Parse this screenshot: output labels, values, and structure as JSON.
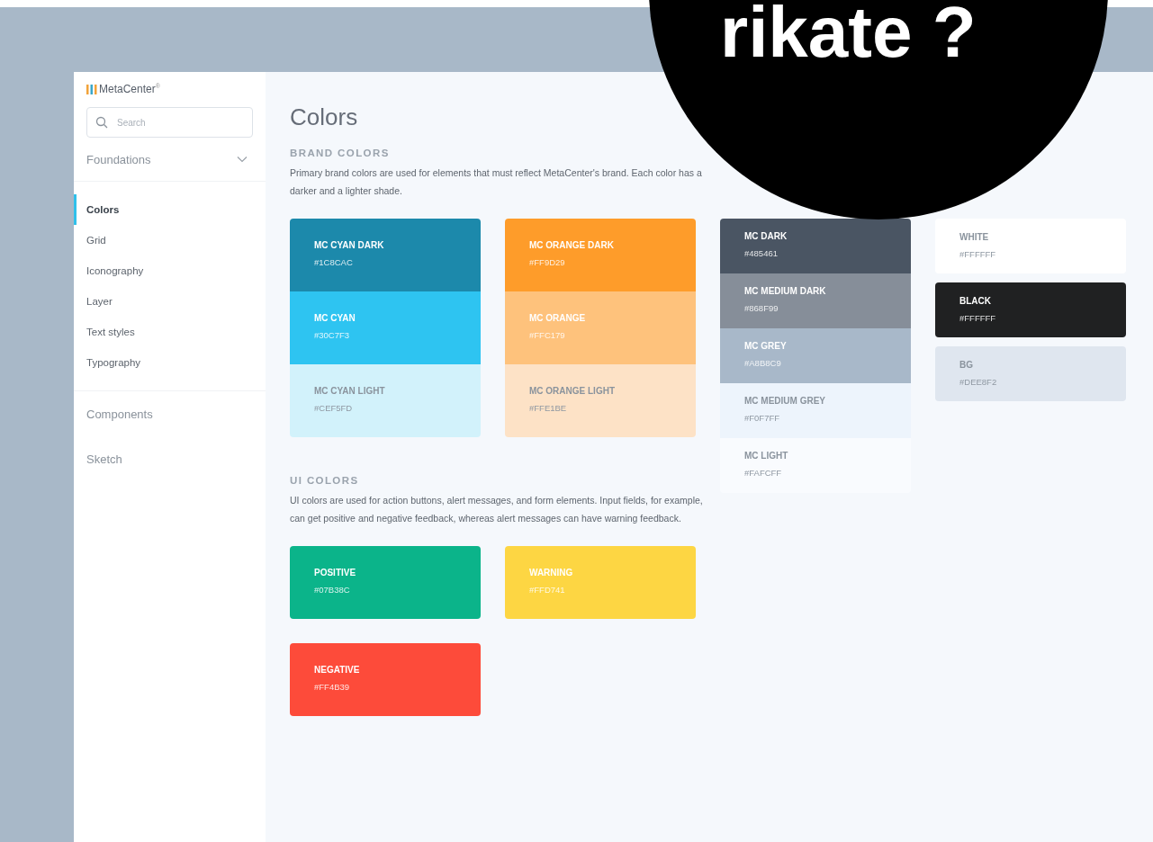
{
  "overlay": {
    "text": "rikate ?"
  },
  "sidebar": {
    "logo": "MetaCenter$^{®}$",
    "search": {
      "placeholder": "Search"
    },
    "sections": [
      {
        "label": "Foundations",
        "expanded": true,
        "children": [
          {
            "label": "Colors",
            "selected": true
          },
          {
            "label": "Grid",
            "selected": false
          },
          {
            "label": "Iconography",
            "selected": false
          },
          {
            "label": "Layer",
            "selected": false
          },
          {
            "label": "Text styles",
            "selected": false
          },
          {
            "label": "Typography",
            "selected": false
          }
        ]
      },
      {
        "label": "Components"
      },
      {
        "label": "Sketch"
      }
    ]
  },
  "main": {
    "title": "Colors",
    "brand": {
      "heading": "BRAND COLORS",
      "description": "Primary brand colors are used for elements that must reflect MetaCenter's brand. Each color has a darker and a lighter shade.",
      "columns": [
        {
          "kind": "brand_stack",
          "swatches": [
            {
              "name": "MC CYAN DARK",
              "hex": "#1C8CAC",
              "color": "#1c89ab"
            },
            {
              "name": "MC CYAN",
              "hex": "#30C7F3",
              "color": "#2ec4f1"
            },
            {
              "name": "MC CYAN LIGHT",
              "hex": "#CEF5FD",
              "color": "#d2f2fb"
            }
          ]
        },
        {
          "kind": "brand_stack",
          "swatches": [
            {
              "name": "MC ORANGE DARK",
              "hex": "#FF9D29",
              "color": "#fe9c2a"
            },
            {
              "name": "MC ORANGE",
              "hex": "#FFC179",
              "color": "#fec27c"
            },
            {
              "name": "MC ORANGE LIGHT",
              "hex": "#FFE1BE",
              "color": "#fde2c6"
            }
          ]
        },
        {
          "kind": "grey_stack",
          "swatches": [
            {
              "name": "MC DARK",
              "hex": "#485461",
              "color": "#4a5563"
            },
            {
              "name": "MC MEDIUM DARK",
              "hex": "#868F99",
              "color": "#868e99"
            },
            {
              "name": "MC GREY",
              "hex": "#A8B8C9",
              "color": "#a8b8c9"
            },
            {
              "name": "MC MEDIUM GREY",
              "hex": "#F0F7FF",
              "color": "#edf4fc"
            },
            {
              "name": "MC LIGHT",
              "hex": "#FAFCFF",
              "color": "#f9fbfe"
            }
          ]
        },
        {
          "kind": "cards",
          "swatches": [
            {
              "name": "WHITE",
              "hex": "#FFFFFF",
              "color": "#ffffff"
            },
            {
              "name": "BLACK",
              "hex": "#FFFFFF",
              "color": "#202122"
            },
            {
              "name": "BG",
              "hex": "#DEE8F2",
              "color": "#dfe6ef"
            }
          ]
        }
      ]
    },
    "ui": {
      "heading": "UI COLORS",
      "description": "UI colors are used for action buttons, alert messages, and form elements. Input fields, for example, can get positive and negative feedback, whereas alert messages can have warning feedback.",
      "swatches": [
        {
          "name": "POSITIVE",
          "hex": "#07B38C",
          "color": "#0bb48a"
        },
        {
          "name": "WARNING",
          "hex": "#FFD741",
          "color": "#fdd643"
        },
        {
          "name": "NEGATIVE",
          "hex": "#FF4B39",
          "color": "#fd4b3a"
        }
      ]
    }
  }
}
